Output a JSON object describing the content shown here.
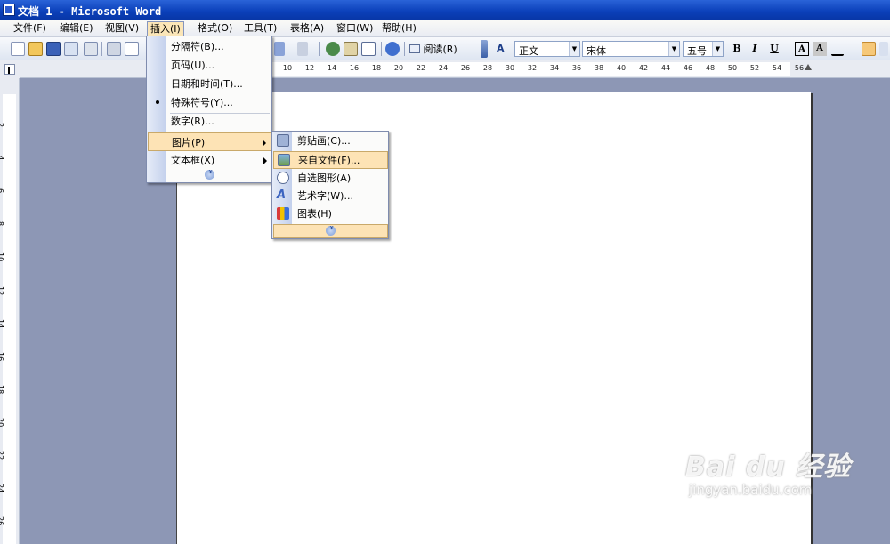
{
  "window": {
    "title": "文档 1 - Microsoft Word"
  },
  "menubar": {
    "items": [
      {
        "label": "文件(F)"
      },
      {
        "label": "编辑(E)"
      },
      {
        "label": "视图(V)"
      },
      {
        "label": "插入(I)"
      },
      {
        "label": "格式(O)"
      },
      {
        "label": "工具(T)"
      },
      {
        "label": "表格(A)"
      },
      {
        "label": "窗口(W)"
      },
      {
        "label": "帮助(H)"
      }
    ],
    "active": "插入(I)"
  },
  "toolbar": {
    "read_label": "阅读(R)",
    "style": "正文",
    "font": "宋体",
    "size": "五号",
    "bold": "B",
    "italic": "I",
    "underline": "U",
    "font_color": "A",
    "char_shading": "A"
  },
  "ruler": {
    "top_ticks": [
      "10",
      "12",
      "14",
      "16",
      "18",
      "20",
      "22",
      "24",
      "26",
      "28",
      "30",
      "32",
      "34",
      "36",
      "38",
      "40",
      "42",
      "44",
      "46",
      "48",
      "50",
      "52",
      "54",
      "56"
    ],
    "left_ticks": [
      "2",
      "4",
      "6",
      "8",
      "10",
      "12",
      "14",
      "16",
      "18",
      "20",
      "22",
      "24",
      "26"
    ]
  },
  "insert_menu": {
    "items": [
      {
        "label": "分隔符(B)..."
      },
      {
        "label": "页码(U)..."
      },
      {
        "label": "日期和时间(T)..."
      },
      {
        "label": "特殊符号(Y)..."
      },
      {
        "label": "数字(R)..."
      },
      {
        "label": "图片(P)"
      },
      {
        "label": "文本框(X)"
      }
    ]
  },
  "picture_menu": {
    "items": [
      {
        "label": "剪贴画(C)...",
        "icon": "clipart-icon"
      },
      {
        "label": "来自文件(F)...",
        "icon": "picture-file-icon"
      },
      {
        "label": "自选图形(A)",
        "icon": "autoshape-icon"
      },
      {
        "label": "艺术字(W)...",
        "icon": "wordart-icon"
      },
      {
        "label": "图表(H)",
        "icon": "chart-icon"
      }
    ],
    "highlighted": "来自文件(F)..."
  },
  "watermark": {
    "brand": "Bai du 经验",
    "url": "jingyan.baidu.com"
  },
  "colors": {
    "title_bar": "#0a3fb9",
    "menu_highlight": "#fde3b5",
    "workspace": "#8d97b5"
  }
}
